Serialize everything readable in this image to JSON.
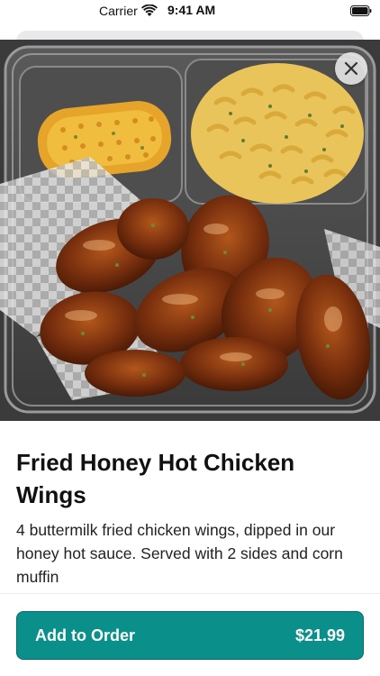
{
  "status_bar": {
    "carrier": "Carrier",
    "time": "9:41 AM"
  },
  "close_icon": "close-icon",
  "item": {
    "title": "Fried Honey Hot Chicken Wings",
    "description": "4 buttermilk fried chicken wings, dipped in our honey hot sauce. Served with 2 sides and corn muffin"
  },
  "order_button": {
    "label": "Add to Order",
    "price": "$21.99",
    "color": "#0a8f8a"
  }
}
